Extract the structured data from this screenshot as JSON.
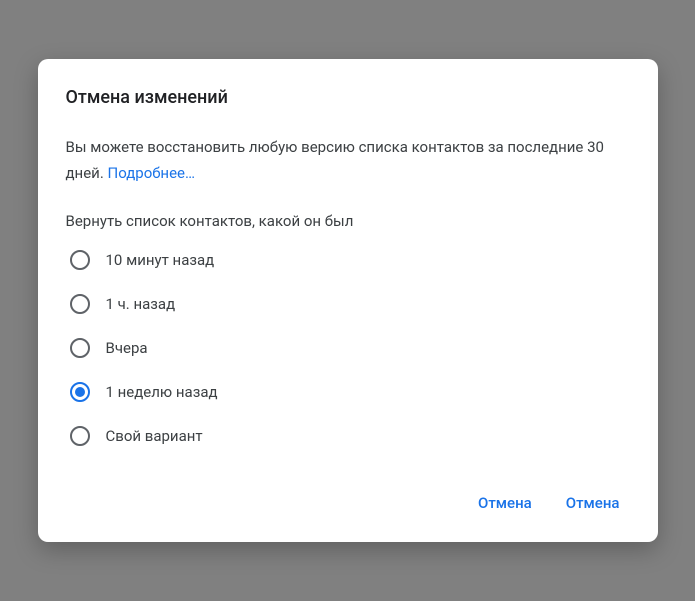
{
  "dialog": {
    "title": "Отмена изменений",
    "description_prefix": "Вы можете восстановить любую версию списка контактов за последние 30 дней. ",
    "learn_more": "Подробнее…",
    "prompt": "Вернуть список контактов, какой он был",
    "options": [
      {
        "label": "10 минут назад",
        "selected": false
      },
      {
        "label": "1 ч. назад",
        "selected": false
      },
      {
        "label": "Вчера",
        "selected": false
      },
      {
        "label": "1 неделю назад",
        "selected": true
      },
      {
        "label": "Свой вариант",
        "selected": false
      }
    ],
    "buttons": {
      "cancel": "Отмена",
      "confirm": "Отмена"
    }
  }
}
